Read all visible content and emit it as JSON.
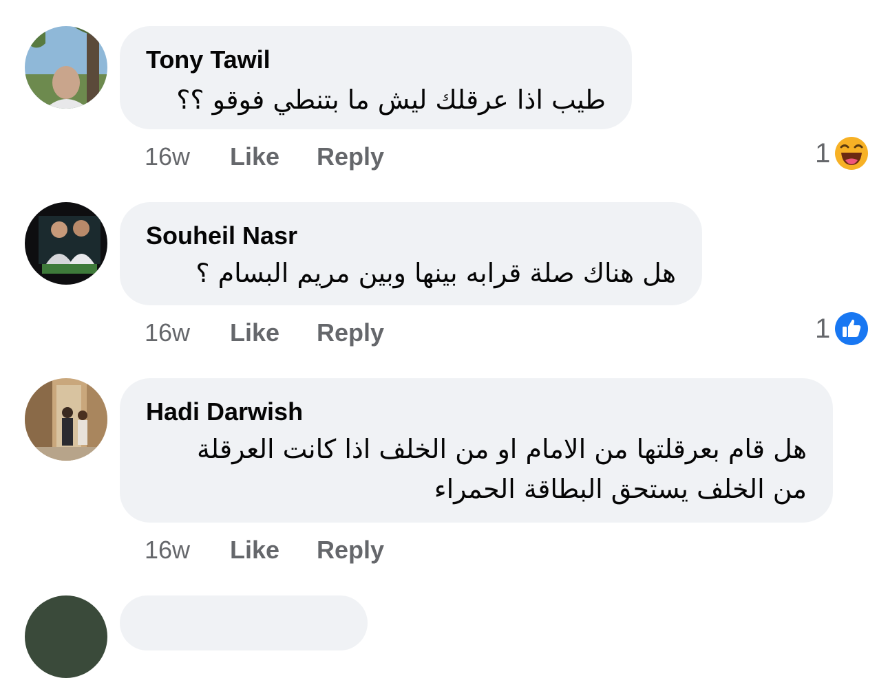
{
  "comments": [
    {
      "author": "Tony Tawil",
      "text_lines": [
        "طيب اذا عرقلك ليش ما بتنطي فوقو ؟؟"
      ],
      "time": "16w",
      "like_label": "Like",
      "reply_label": "Reply",
      "reaction": {
        "count": "1",
        "icon": "haha-emoji-icon"
      }
    },
    {
      "author": "Souheil Nasr",
      "text_lines": [
        "هل هناك صلة قرابه بينها وبين مريم البسام ؟"
      ],
      "time": "16w",
      "like_label": "Like",
      "reply_label": "Reply",
      "reaction": {
        "count": "1",
        "icon": "like-thumb-icon"
      }
    },
    {
      "author": "Hadi Darwish",
      "text_lines": [
        "هل قام بعرقلتها من الامام او من الخلف اذا كانت العرقلة",
        "من الخلف يستحق البطاقة الحمراء"
      ],
      "time": "16w",
      "like_label": "Like",
      "reply_label": "Reply"
    }
  ],
  "colors": {
    "bubble_bg": "#f0f2f5",
    "meta_text": "#65676b",
    "like_blue": "#1877f2",
    "haha_yellow": "#f7b125"
  }
}
